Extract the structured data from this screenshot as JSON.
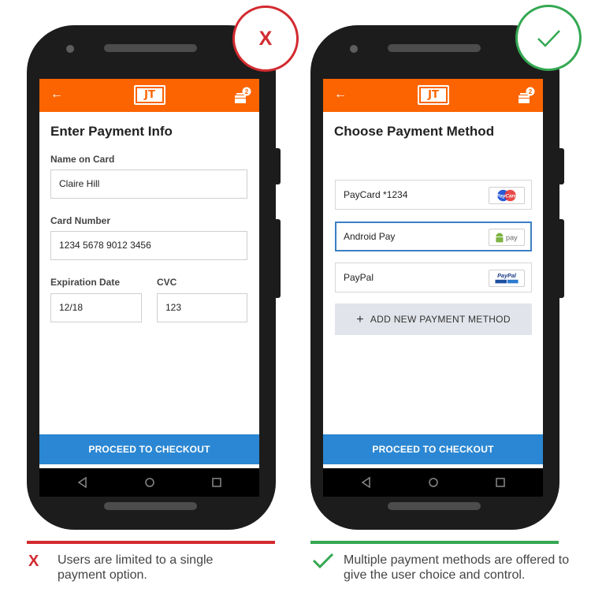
{
  "left_phone": {
    "title": "Enter Payment Info",
    "name_label": "Name on Card",
    "name_value": "Claire Hill",
    "card_label": "Card Number",
    "card_value": "1234 5678 9012 3456",
    "exp_label": "Expiration Date",
    "exp_value": "12/18",
    "cvc_label": "CVC",
    "cvc_value": "123",
    "checkout_label": "PROCEED TO CHECKOUT",
    "verdict_mark": "X"
  },
  "right_phone": {
    "title": "Choose Payment Method",
    "methods": [
      {
        "label": "PayCard *1234",
        "badge_text": "PayCard",
        "icon": "paycard-logo-icon"
      },
      {
        "label": "Android Pay",
        "badge_text": "pay",
        "icon": "android-pay-logo-icon",
        "selected": true
      },
      {
        "label": "PayPal",
        "badge_text": "PayPal",
        "icon": "paypal-logo-icon"
      }
    ],
    "add_label": "ADD NEW PAYMENT METHOD",
    "add_symbol": "+",
    "checkout_label": "PROCEED TO CHECKOUT"
  },
  "appbar": {
    "back_symbol": "←",
    "logo_text": "JT",
    "cart_count": "2"
  },
  "captions": {
    "bad_mark": "X",
    "bad": "Users are limited to a single payment option.",
    "good": "Multiple payment methods are offered to give the user choice and control."
  },
  "colors": {
    "brand_orange": "#fb6400",
    "checkout_blue": "#2b87d3",
    "bad_red": "#d32a2f",
    "good_green": "#34a852",
    "selected_border": "#3b7fc4"
  }
}
